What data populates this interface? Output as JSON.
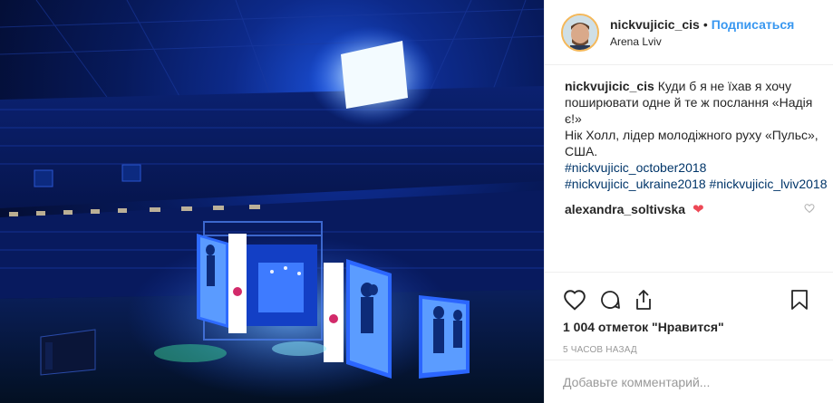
{
  "post": {
    "username": "nickvujicic_cis",
    "separator": "•",
    "follow_label": "Подписаться",
    "location": "Arena Lviv",
    "caption": {
      "author": "nickvujicic_cis",
      "text_1": "Куди б я не їхав я хочу поширювати одне й те ж послання «Надія є!»",
      "text_2": "Нік Холл, лідер молодіжного руху «Пульс», США.",
      "hashtags": [
        "#nickvujicic_october2018",
        "#nickvujicic_ukraine2018",
        "#nickvujicic_lviv2018"
      ]
    },
    "comment": {
      "author": "alexandra_soltivska",
      "emoji": "heart"
    },
    "likes_text": "1 004 отметок \"Нравится\"",
    "time_text": "5 часов назад",
    "comment_placeholder": "Добавьте комментарий...",
    "icons": [
      "heart-icon",
      "comment-icon",
      "share-icon",
      "bookmark-icon"
    ],
    "colors": {
      "link": "#3897f0",
      "hashtag": "#003569",
      "heart": "#ed4956",
      "muted": "#999999"
    }
  }
}
